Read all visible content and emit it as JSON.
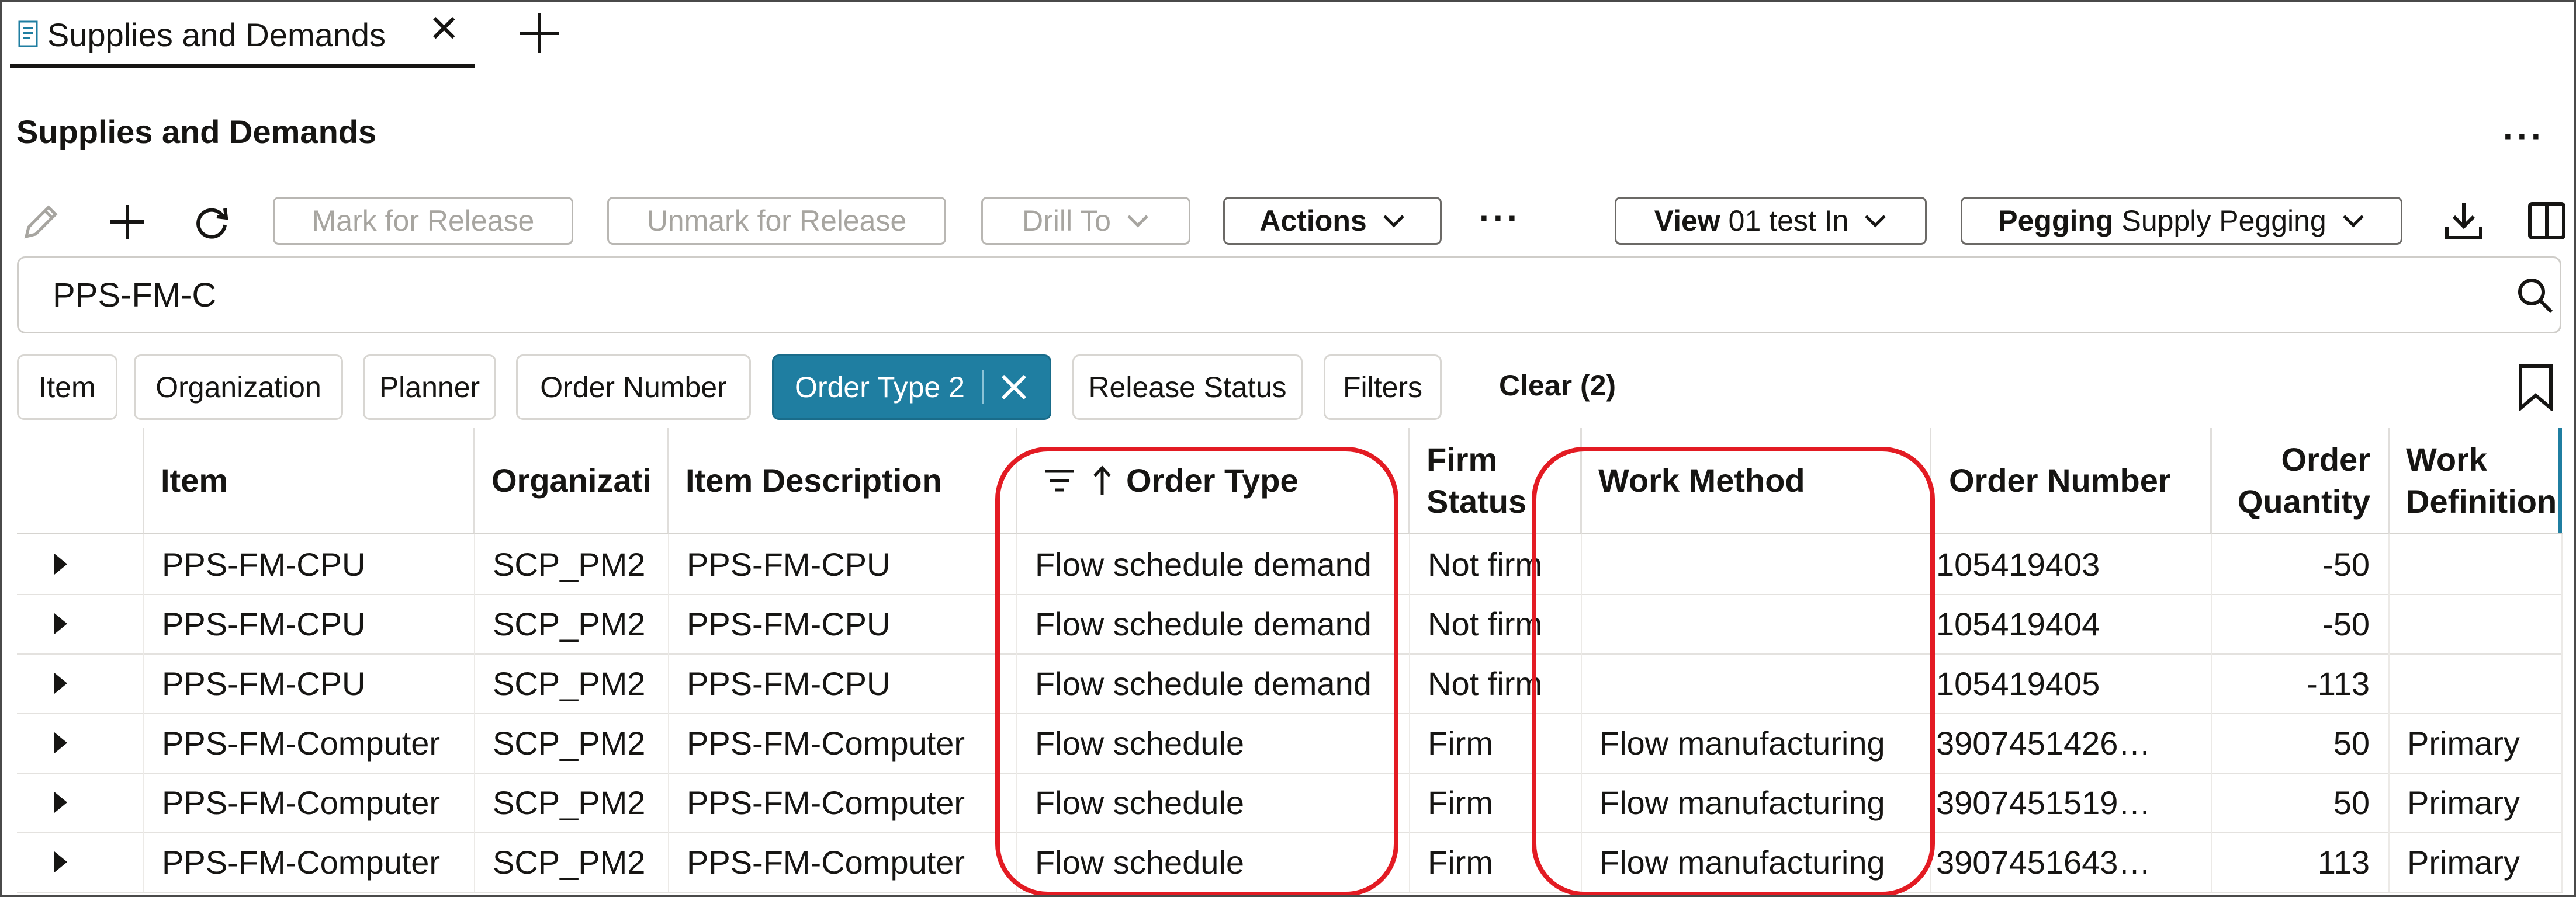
{
  "tab": {
    "title": "Supplies and Demands",
    "close": "✕"
  },
  "page": {
    "title": "Supplies and Demands",
    "more": "···"
  },
  "toolbar": {
    "mark_for_release": "Mark for Release",
    "unmark_for_release": "Unmark for Release",
    "drill_to": "Drill To",
    "actions": "Actions",
    "more": "···",
    "view_label": "View",
    "view_value": "01 test In",
    "pegging_label": "Pegging",
    "pegging_value": "Supply Pegging"
  },
  "search": {
    "value": "PPS-FM-C"
  },
  "filters": {
    "chips": [
      "Item",
      "Organization",
      "Planner",
      "Order Number"
    ],
    "selected_chip": "Order Type 2",
    "release_status": "Release Status",
    "filters": "Filters",
    "clear": "Clear (2)"
  },
  "table": {
    "columns": [
      "Item",
      "Organizati",
      "Item Description",
      "Order Type",
      "Firm Status",
      "Work Method",
      "Order Number",
      "Order Quantity",
      "Work Definition"
    ],
    "header_two_line": {
      "firm_1": "Firm",
      "firm_2": "Status",
      "qty_1": "Order",
      "qty_2": "Quantity",
      "wd_1": "Work",
      "wd_2": "Definition"
    },
    "rows": [
      {
        "item": "PPS-FM-CPU",
        "org": "SCP_PM2",
        "desc": "PPS-FM-CPU",
        "order_type": "Flow schedule demand",
        "firm": "Not firm",
        "method": "",
        "order_number": "105419403",
        "qty": "-50",
        "work_def": ""
      },
      {
        "item": "PPS-FM-CPU",
        "org": "SCP_PM2",
        "desc": "PPS-FM-CPU",
        "order_type": "Flow schedule demand",
        "firm": "Not firm",
        "method": "",
        "order_number": "105419404",
        "qty": "-50",
        "work_def": ""
      },
      {
        "item": "PPS-FM-CPU",
        "org": "SCP_PM2",
        "desc": "PPS-FM-CPU",
        "order_type": "Flow schedule demand",
        "firm": "Not firm",
        "method": "",
        "order_number": "105419405",
        "qty": "-113",
        "work_def": ""
      },
      {
        "item": "PPS-FM-Computer",
        "org": "SCP_PM2",
        "desc": "PPS-FM-Computer",
        "order_type": "Flow schedule",
        "firm": "Firm",
        "method": "Flow manufacturing",
        "order_number": "3907451426…",
        "qty": "50",
        "work_def": "Primary"
      },
      {
        "item": "PPS-FM-Computer",
        "org": "SCP_PM2",
        "desc": "PPS-FM-Computer",
        "order_type": "Flow schedule",
        "firm": "Firm",
        "method": "Flow manufacturing",
        "order_number": "3907451519…",
        "qty": "50",
        "work_def": "Primary"
      },
      {
        "item": "PPS-FM-Computer",
        "org": "SCP_PM2",
        "desc": "PPS-FM-Computer",
        "order_type": "Flow schedule",
        "firm": "Firm",
        "method": "Flow manufacturing",
        "order_number": "3907451643…",
        "qty": "113",
        "work_def": "Primary"
      }
    ]
  },
  "colors": {
    "accent": "#1f7ea1",
    "highlight": "#e31b23",
    "text": "#161513",
    "disabled": "#a7a5a0"
  }
}
